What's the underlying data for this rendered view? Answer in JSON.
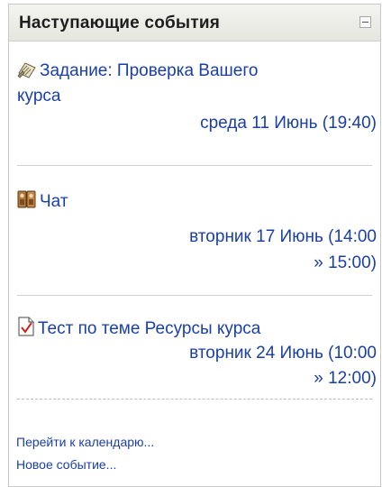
{
  "block": {
    "title": "Наступающие события",
    "collapse_icon": "minus-box-icon"
  },
  "events": [
    {
      "icon": "assignment-icon",
      "title_line1": "Задание: Проверка Вашего",
      "title_line2": "курса",
      "date_line": "среда 11 Июнь (19:40)"
    },
    {
      "icon": "chat-icon",
      "title": "Чат",
      "date_line1": "вторник 17 Июнь (14:00",
      "date_line2": "» 15:00)"
    },
    {
      "icon": "quiz-icon",
      "title": "Тест по теме Ресурсы курса",
      "date_line1": "вторник 24 Июнь (10:00",
      "date_line2": "» 12:00)"
    }
  ],
  "footer": {
    "calendar_link": "Перейти к календарю...",
    "new_event_link": "Новое событие..."
  },
  "colors": {
    "link": "#1a3fa8",
    "header_bg": "#e9e9e4",
    "border": "#c8c8c8"
  }
}
